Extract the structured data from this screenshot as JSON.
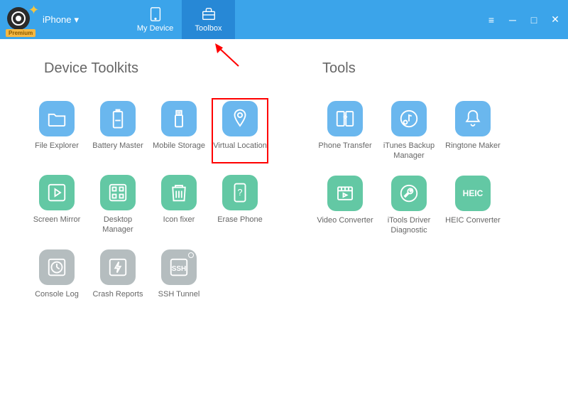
{
  "header": {
    "device_label": "iPhone",
    "premium_text": "Premium",
    "tabs": {
      "my_device": "My Device",
      "toolbox": "Toolbox"
    }
  },
  "sections": {
    "device_toolkits_title": "Device Toolkits",
    "tools_title": "Tools"
  },
  "device_toolkits": {
    "file_explorer": "File Explorer",
    "battery_master": "Battery Master",
    "mobile_storage": "Mobile Storage",
    "virtual_location": "Virtual Location",
    "screen_mirror": "Screen Mirror",
    "desktop_manager": "Desktop Manager",
    "icon_fixer": "Icon fixer",
    "erase_phone": "Erase Phone",
    "console_log": "Console Log",
    "crash_reports": "Crash Reports",
    "ssh_tunnel": "SSH Tunnel"
  },
  "tools": {
    "phone_transfer": "Phone Transfer",
    "itunes_backup_manager": "iTunes Backup Manager",
    "ringtone_maker": "Ringtone Maker",
    "video_converter": "Video Converter",
    "itools_driver_diagnostic": "iTools Driver Diagnostic",
    "heic_converter": "HEIC Converter",
    "heic_text": "HEIC"
  },
  "colors": {
    "header_blue": "#3ba4ea",
    "tab_active": "#2788d6",
    "icon_blue": "#6ab7ee",
    "icon_green": "#63c8a4",
    "icon_gray": "#b5bdbf",
    "highlight_red": "#ff0000"
  }
}
